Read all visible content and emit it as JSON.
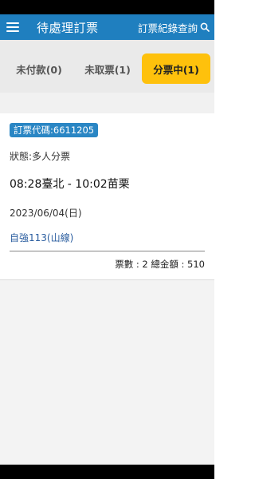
{
  "app_bar": {
    "title": "待處理訂票",
    "history_label": "訂票紀錄查詢",
    "menu_icon": "hamburger-menu-icon",
    "search_icon": "search-icon",
    "color": "#1f7fbf"
  },
  "tabs": [
    {
      "label": "未付款(0)",
      "active": false
    },
    {
      "label": "未取票(1)",
      "active": false
    },
    {
      "label": "分票中(1)",
      "active": true
    }
  ],
  "active_tab_color": "#fec10c",
  "ticket": {
    "code": "訂票代碼:6611205",
    "status": "狀態:多人分票",
    "route": "08:28臺北 - 10:02苗栗",
    "date": "2023/06/04(日)",
    "train": "自強113(山線)",
    "summary": "票數 : 2 總金額 : 510"
  }
}
